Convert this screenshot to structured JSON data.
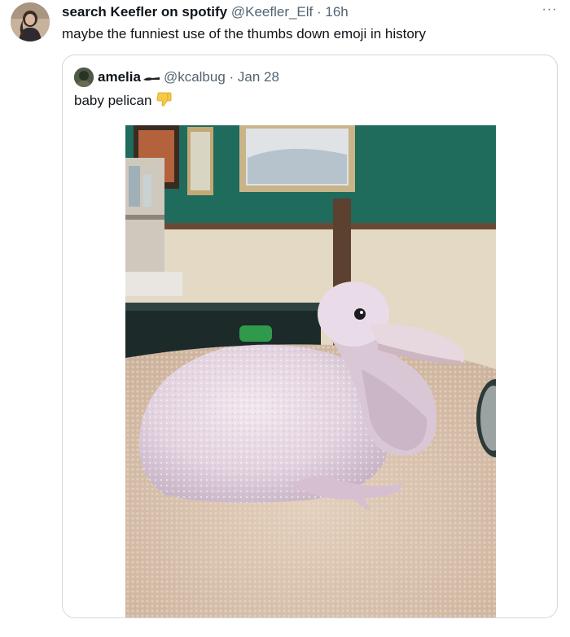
{
  "tweet": {
    "author_name": "search Keefler on spotify",
    "author_handle": "@Keefler_Elf",
    "separator": " · ",
    "time": "16h",
    "text": "maybe the funniest use of the thumbs down emoji in history",
    "more_label": "···"
  },
  "quoted_tweet": {
    "author_name": "amelia",
    "author_handle": "@kcalbug",
    "separator": " · ",
    "date": "Jan 28",
    "text": "baby pelican",
    "emoji_icon": "thumbs-down-icon",
    "image_subject": "baby pelican photo"
  },
  "colors": {
    "text_primary": "#0f1419",
    "text_secondary": "#536471",
    "border": "#cfd9de",
    "wall_green": "#1f6b5c",
    "towel": "#d8c2ad",
    "chick_skin": "#e6d7e2"
  }
}
